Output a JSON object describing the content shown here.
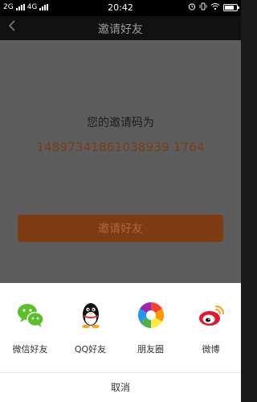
{
  "status_bar": {
    "network_left": "2G",
    "network_right": "4G",
    "time": "20:42"
  },
  "header": {
    "back_icon": "chevron-left-icon",
    "title": "邀请好友"
  },
  "main": {
    "invite_label": "您的邀请码为",
    "invite_code": "14897341861038939 1764",
    "button_label": "邀请好友"
  },
  "share": {
    "items": [
      {
        "label": "微信好友",
        "icon": "wechat-icon"
      },
      {
        "label": "QQ好友",
        "icon": "qq-icon"
      },
      {
        "label": "朋友圈",
        "icon": "moments-icon"
      },
      {
        "label": "微博",
        "icon": "weibo-icon"
      }
    ],
    "cancel_label": "取消"
  },
  "colors": {
    "overlay": "#5d5d5d",
    "code_text": "#7a3d17",
    "button_bg": "#7e3a10",
    "wechat": "#5bbf2a",
    "weibo": "#e6162d"
  }
}
